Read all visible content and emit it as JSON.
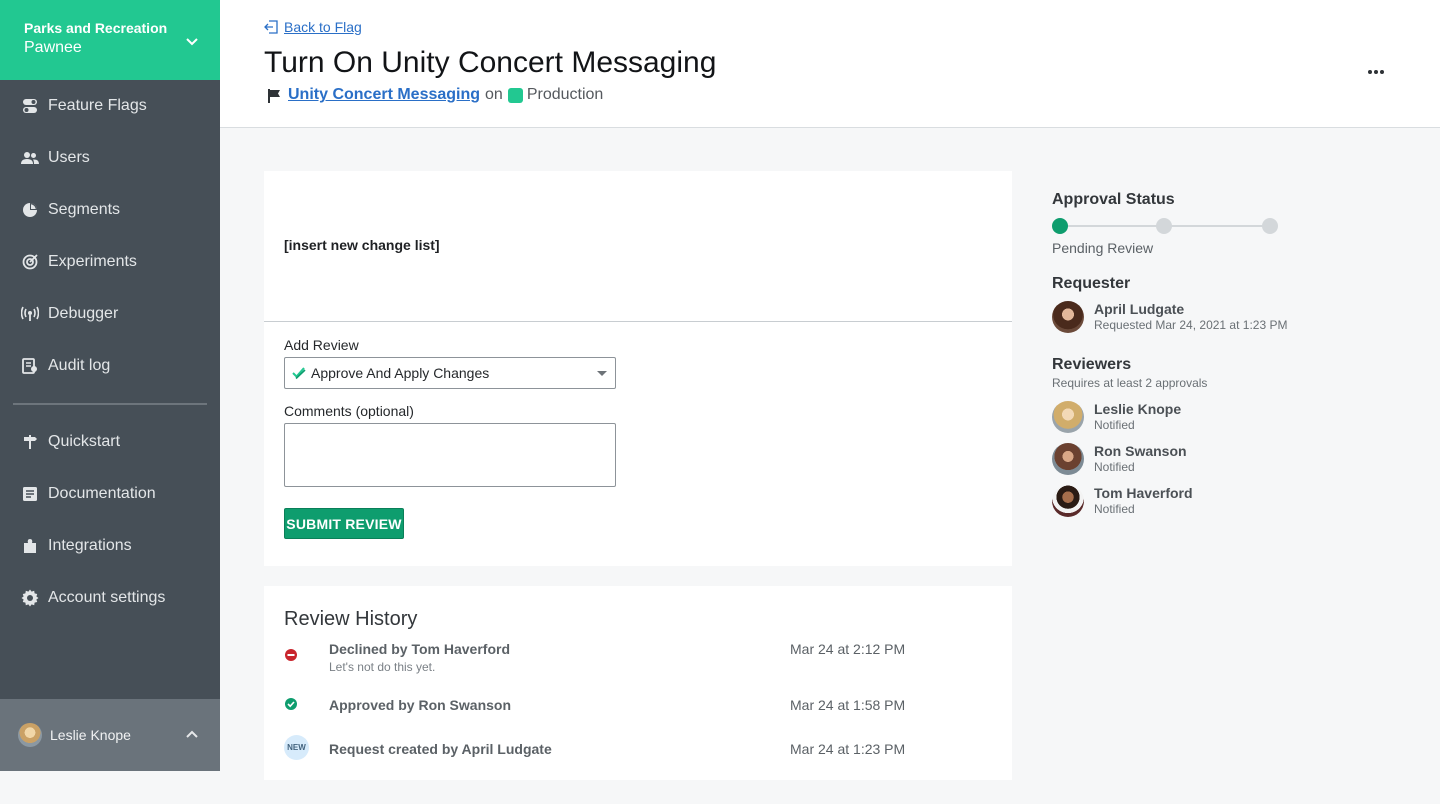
{
  "project": {
    "name": "Parks and Recreation",
    "environment": "Pawnee"
  },
  "nav": {
    "items": [
      {
        "label": "Feature Flags",
        "icon": "toggle-icon"
      },
      {
        "label": "Users",
        "icon": "users-icon"
      },
      {
        "label": "Segments",
        "icon": "pie-icon"
      },
      {
        "label": "Experiments",
        "icon": "target-icon"
      },
      {
        "label": "Debugger",
        "icon": "antenna-icon"
      },
      {
        "label": "Audit log",
        "icon": "audit-icon"
      }
    ],
    "secondary": [
      {
        "label": "Quickstart",
        "icon": "signpost-icon"
      },
      {
        "label": "Documentation",
        "icon": "document-icon"
      },
      {
        "label": "Integrations",
        "icon": "puzzle-icon"
      },
      {
        "label": "Account settings",
        "icon": "gear-icon"
      }
    ],
    "user": "Leslie Knope"
  },
  "header": {
    "back_label": "Back to Flag",
    "title": "Turn On Unity Concert Messaging",
    "flag_name": "Unity Concert Messaging",
    "on_word": "on",
    "environment": "Production"
  },
  "change": {
    "text": "[insert new change list]"
  },
  "review_form": {
    "add_review_label": "Add Review",
    "selected_option": "Approve And Apply Changes",
    "comments_label": "Comments (optional)",
    "comments_value": "",
    "submit_label": "SUBMIT REVIEW"
  },
  "history": {
    "title": "Review History",
    "items": [
      {
        "text": "Declined by Tom Haverford",
        "sub": "Let's not do this yet.",
        "date": "Mar 24 at 2:12 PM",
        "status": "declined"
      },
      {
        "text": "Approved by Ron Swanson",
        "sub": "",
        "date": "Mar 24 at 1:58 PM",
        "status": "approved"
      },
      {
        "text": "Request created by April Ludgate",
        "sub": "",
        "date": "Mar 24 at 1:23 PM",
        "status": "new",
        "badge": "NEW"
      }
    ]
  },
  "approval": {
    "title": "Approval Status",
    "status": "Pending Review",
    "steps_completed": 1,
    "steps_total": 3
  },
  "requester": {
    "title": "Requester",
    "name": "April Ludgate",
    "detail": "Requested Mar 24, 2021 at 1:23 PM"
  },
  "reviewers": {
    "title": "Reviewers",
    "requirement": "Requires at least 2 approvals",
    "items": [
      {
        "name": "Leslie Knope",
        "status": "Notified"
      },
      {
        "name": "Ron Swanson",
        "status": "Notified"
      },
      {
        "name": "Tom Haverford",
        "status": "Notified"
      }
    ]
  },
  "colors": {
    "brand": "#22c891",
    "primary": "#0e9d6e",
    "sidebar": "#464f57",
    "link": "#2a6fc7",
    "danger": "#c9252d"
  }
}
